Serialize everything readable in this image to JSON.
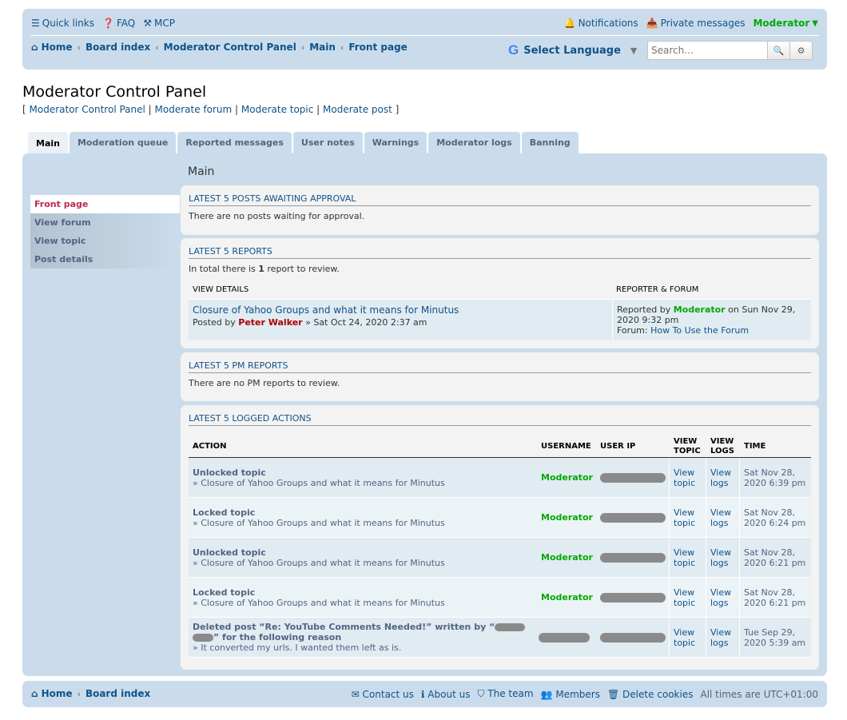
{
  "header": {
    "quick_links": "Quick links",
    "faq": "FAQ",
    "mcp": "MCP",
    "notifications": "Notifications",
    "private_messages": "Private messages",
    "username": "Moderator",
    "breadcrumbs": [
      "Home",
      "Board index",
      "Moderator Control Panel",
      "Main",
      "Front page"
    ],
    "translate_label": "Select Language",
    "search_placeholder": "Search…"
  },
  "page": {
    "title": "Moderator Control Panel",
    "quick_nav": [
      "Moderator Control Panel",
      "Moderate forum",
      "Moderate topic",
      "Moderate post"
    ]
  },
  "tabs": [
    "Main",
    "Moderation queue",
    "Reported messages",
    "User notes",
    "Warnings",
    "Moderator logs",
    "Banning"
  ],
  "main": {
    "heading": "Main",
    "side_menu": [
      "Front page",
      "View forum",
      "View topic",
      "Post details"
    ]
  },
  "posts_awaiting": {
    "title": "Latest 5 posts awaiting approval",
    "text": "There are no posts waiting for approval."
  },
  "reports": {
    "title": "Latest 5 reports",
    "total_prefix": "In total there is ",
    "total_count": "1",
    "total_suffix": " report to review.",
    "col_details": "View details",
    "col_reporter": "Reporter & Forum",
    "row": {
      "topic": "Closure of Yahoo Groups and what it means for Minutus",
      "posted_by_label": "Posted by ",
      "poster": "Peter Walker",
      "posted_time": " » Sat Oct 24, 2020 2:37 am",
      "reported_by_label": "Reported by ",
      "reporter": "Moderator",
      "reported_time": " on Sun Nov 29, 2020 9:32 pm",
      "forum_label": "Forum: ",
      "forum": "How To Use the Forum"
    }
  },
  "pm_reports": {
    "title": "Latest 5 PM reports",
    "text": "There are no PM reports to review."
  },
  "logs": {
    "title": "Latest 5 logged actions",
    "cols": {
      "action": "Action",
      "username": "Username",
      "user_ip": "User IP",
      "view_topic": "View topic",
      "view_logs": "View logs",
      "time": "Time"
    },
    "rows": [
      {
        "action": "Unlocked topic",
        "sub": "» Closure of Yahoo Groups and what it means for Minutus",
        "user": "Moderator",
        "view_topic": "View topic",
        "view_logs": "View logs",
        "time": "Sat Nov 28, 2020 6:39 pm"
      },
      {
        "action": "Locked topic",
        "sub": "» Closure of Yahoo Groups and what it means for Minutus",
        "user": "Moderator",
        "view_topic": "View topic",
        "view_logs": "View logs",
        "time": "Sat Nov 28, 2020 6:24 pm"
      },
      {
        "action": "Unlocked topic",
        "sub": "» Closure of Yahoo Groups and what it means for Minutus",
        "user": "Moderator",
        "view_topic": "View topic",
        "view_logs": "View logs",
        "time": "Sat Nov 28, 2020 6:21 pm"
      },
      {
        "action": "Locked topic",
        "sub": "» Closure of Yahoo Groups and what it means for Minutus",
        "user": "Moderator",
        "view_topic": "View topic",
        "view_logs": "View logs",
        "time": "Sat Nov 28, 2020 6:21 pm"
      },
      {
        "action_a": "Deleted post “Re: YouTube Comments Needed!” written by “",
        "action_b": "” for the following reason",
        "sub": "» It converted my urls. I wanted them left as is.",
        "view_topic": "View topic",
        "view_logs": "View logs",
        "time": "Tue Sep 29, 2020 5:39 am"
      }
    ]
  },
  "footer": {
    "breadcrumbs": [
      "Home",
      "Board index"
    ],
    "contact": "Contact us",
    "about": "About us",
    "team": "The team",
    "members": "Members",
    "delete_cookies": "Delete cookies",
    "timezone": "All times are UTC+01:00"
  },
  "colors": {
    "accent": "#105289",
    "panel": "#cadceb",
    "moderator": "#00aa00",
    "poster": "#aa0000",
    "active_menu": "#bc2a4d"
  }
}
